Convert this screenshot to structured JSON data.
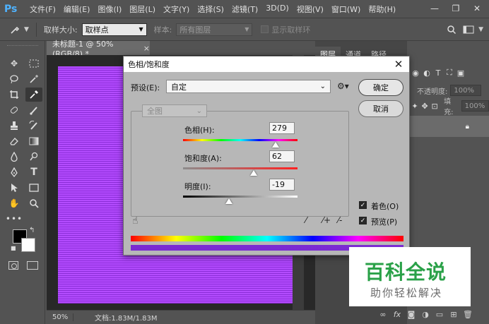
{
  "app": {
    "logo": "Ps",
    "menus": [
      "文件(F)",
      "编辑(E)",
      "图像(I)",
      "图层(L)",
      "文字(Y)",
      "选择(S)",
      "滤镜(T)",
      "3D(D)",
      "视图(V)",
      "窗口(W)",
      "帮助(H)"
    ],
    "window_controls": {
      "minimize": "—",
      "restore": "❐",
      "close": "✕"
    }
  },
  "options": {
    "sample_size_label": "取样大小:",
    "sample_size_value": "取样点",
    "sample_label": "样本:",
    "sample_value": "所有图层",
    "show_ring_label": "显示取样环"
  },
  "document": {
    "tab_title": "未标题-1 @ 50%(RGB/8) *",
    "tab_close": "×",
    "zoom": "50%",
    "doc_info": "文档:1.83M/1.83M"
  },
  "panels": {
    "tabs": [
      "图层",
      "通道",
      "路径"
    ],
    "opacity_label": "不透明度:",
    "opacity_value": "100%",
    "fill_label": "填充:",
    "fill_value": "100%"
  },
  "dialog": {
    "title": "色相/饱和度",
    "close": "✕",
    "preset_label": "预设(E):",
    "preset_value": "自定",
    "ok_label": "确定",
    "cancel_label": "取消",
    "channel_value": "全图",
    "hue_label": "色相(H):",
    "hue_value": "279",
    "hue_fraction": 0.81,
    "saturation_label": "饱和度(A):",
    "saturation_value": "62",
    "saturation_fraction": 0.62,
    "lightness_label": "明度(I):",
    "lightness_value": "-19",
    "lightness_fraction": 0.4,
    "colorize_label": "着色(O)",
    "preview_label": "预览(P)",
    "check_mark": "✓"
  },
  "watermark": {
    "title": "百科全说",
    "subtitle": "助你轻松解决"
  },
  "colors": {
    "canvas_stripe_light": "#b44cff",
    "canvas_stripe_dark": "#8a2cd6",
    "watermark_green": "#2aa148"
  }
}
